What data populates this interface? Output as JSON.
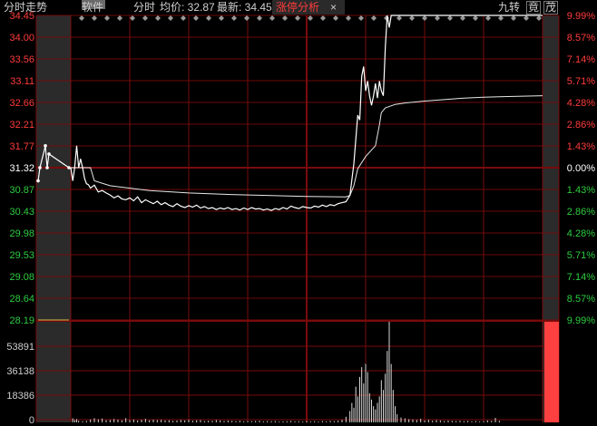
{
  "header": {
    "chart_title": "分时走势",
    "stock_name_suffix": "软件",
    "view_mode": "分时",
    "avg_label": "均价: 32.87",
    "latest_label": "最新: 34.45",
    "tab_label": "涨停分析",
    "tab_close": "×",
    "right_buttons": [
      "九转",
      "竟",
      "茂"
    ]
  },
  "colors": {
    "background": "#000000",
    "grid": "#7a0b0b",
    "price_axis": "#ff3b3b",
    "down_axis": "#2ecc40",
    "price_line": "#ffffff",
    "avg_line": "#e8e8e8",
    "volume": "#d8d8d8",
    "limit_up_bar": "#ff4040"
  },
  "chart_data": {
    "type": "line",
    "prev_close": 31.32,
    "price_range": [
      28.19,
      34.45
    ],
    "y_ticks_left": [
      "34.45",
      "34.00",
      "33.56",
      "33.11",
      "32.66",
      "32.21",
      "31.77",
      "31.32",
      "30.87",
      "30.43",
      "29.98",
      "29.53",
      "29.08",
      "28.64",
      "28.19"
    ],
    "y_ticks_right": [
      "9.99%",
      "8.57%",
      "7.14%",
      "5.71%",
      "4.28%",
      "2.86%",
      "1.43%",
      "0.00%",
      "1.43%",
      "2.86%",
      "4.28%",
      "5.71%",
      "7.14%",
      "8.57%",
      "9.99%"
    ],
    "volume_ticks": [
      "53891",
      "36138",
      "18386",
      "0"
    ],
    "volume_max": 62000,
    "series": [
      {
        "values": [
          [
            0,
            31.32
          ],
          [
            1,
            31.05
          ],
          [
            2,
            31.32
          ],
          [
            3,
            31.77
          ],
          [
            4,
            31.32
          ],
          [
            5,
            31.5
          ],
          [
            6,
            31.32
          ],
          [
            7,
            31.1
          ],
          [
            8,
            30.99
          ],
          [
            9,
            30.97
          ],
          [
            10,
            30.9
          ],
          [
            12,
            30.96
          ],
          [
            14,
            30.82
          ],
          [
            16,
            30.85
          ],
          [
            18,
            30.8
          ],
          [
            20,
            30.76
          ],
          [
            22,
            30.7
          ],
          [
            24,
            30.74
          ],
          [
            26,
            30.68
          ],
          [
            28,
            30.66
          ],
          [
            30,
            30.7
          ],
          [
            32,
            30.64
          ],
          [
            34,
            30.72
          ],
          [
            36,
            30.6
          ],
          [
            38,
            30.66
          ],
          [
            40,
            30.62
          ],
          [
            42,
            30.58
          ],
          [
            44,
            30.63
          ],
          [
            46,
            30.56
          ],
          [
            48,
            30.6
          ],
          [
            50,
            30.55
          ],
          [
            52,
            30.52
          ],
          [
            54,
            30.58
          ],
          [
            56,
            30.53
          ],
          [
            58,
            30.5
          ],
          [
            60,
            30.54
          ],
          [
            62,
            30.51
          ],
          [
            64,
            30.55
          ],
          [
            66,
            30.49
          ],
          [
            68,
            30.52
          ],
          [
            70,
            30.48
          ],
          [
            72,
            30.5
          ],
          [
            74,
            30.46
          ],
          [
            76,
            30.49
          ],
          [
            78,
            30.47
          ],
          [
            80,
            30.5
          ],
          [
            82,
            30.46
          ],
          [
            84,
            30.48
          ],
          [
            86,
            30.45
          ],
          [
            88,
            30.49
          ],
          [
            90,
            30.46
          ],
          [
            92,
            30.5
          ],
          [
            94,
            30.47
          ],
          [
            96,
            30.48
          ],
          [
            98,
            30.45
          ],
          [
            100,
            30.47
          ],
          [
            102,
            30.44
          ],
          [
            104,
            30.48
          ],
          [
            106,
            30.46
          ],
          [
            108,
            30.5
          ],
          [
            110,
            30.47
          ],
          [
            112,
            30.53
          ],
          [
            114,
            30.5
          ],
          [
            116,
            30.48
          ],
          [
            118,
            30.52
          ],
          [
            120,
            30.5
          ],
          [
            122,
            30.49
          ],
          [
            124,
            30.53
          ],
          [
            126,
            30.51
          ],
          [
            128,
            30.55
          ],
          [
            130,
            30.52
          ],
          [
            132,
            30.56
          ],
          [
            134,
            30.54
          ],
          [
            136,
            30.58
          ],
          [
            138,
            30.6
          ],
          [
            140,
            30.62
          ],
          [
            142,
            30.75
          ],
          [
            144,
            31.4
          ],
          [
            146,
            32.4
          ],
          [
            147,
            32.3
          ],
          [
            148,
            33.2
          ],
          [
            149,
            33.4
          ],
          [
            150,
            32.9
          ],
          [
            151,
            33.1
          ],
          [
            152,
            32.8
          ],
          [
            153,
            32.6
          ],
          [
            154,
            32.8
          ],
          [
            155,
            33.05
          ],
          [
            156,
            32.75
          ],
          [
            157,
            33.1
          ],
          [
            158,
            32.9
          ],
          [
            159,
            32.8
          ],
          [
            160,
            33.8
          ],
          [
            161,
            34.45
          ],
          [
            162,
            34.2
          ],
          [
            163,
            34.45
          ],
          [
            166,
            34.45
          ],
          [
            180,
            34.45
          ],
          [
            200,
            34.45
          ],
          [
            230,
            34.45
          ],
          [
            240,
            34.45
          ]
        ]
      },
      {
        "values": [
          [
            0,
            31.32
          ],
          [
            10,
            31.32
          ],
          [
            12,
            31.05
          ],
          [
            20,
            30.95
          ],
          [
            40,
            30.85
          ],
          [
            60,
            30.8
          ],
          [
            80,
            30.77
          ],
          [
            100,
            30.75
          ],
          [
            120,
            30.73
          ],
          [
            140,
            30.72
          ],
          [
            142,
            30.75
          ],
          [
            144,
            30.95
          ],
          [
            146,
            31.3
          ],
          [
            150,
            31.55
          ],
          [
            155,
            31.77
          ],
          [
            157,
            32.2
          ],
          [
            158,
            32.45
          ],
          [
            160,
            32.55
          ],
          [
            165,
            32.62
          ],
          [
            170,
            32.65
          ],
          [
            180,
            32.69
          ],
          [
            190,
            32.72
          ],
          [
            200,
            32.75
          ],
          [
            210,
            32.77
          ],
          [
            220,
            32.78
          ],
          [
            240,
            32.8
          ]
        ]
      }
    ],
    "volume": [
      [
        1,
        2500
      ],
      [
        2,
        1500
      ],
      [
        3,
        2000
      ],
      [
        4,
        1000
      ],
      [
        6,
        600
      ],
      [
        8,
        900
      ],
      [
        10,
        1800
      ],
      [
        12,
        2600
      ],
      [
        14,
        1900
      ],
      [
        16,
        2400
      ],
      [
        18,
        1300
      ],
      [
        20,
        1500
      ],
      [
        22,
        2100
      ],
      [
        24,
        1700
      ],
      [
        26,
        1200
      ],
      [
        28,
        2600
      ],
      [
        30,
        1400
      ],
      [
        32,
        1800
      ],
      [
        34,
        1200
      ],
      [
        36,
        1600
      ],
      [
        38,
        2200
      ],
      [
        40,
        1300
      ],
      [
        42,
        1700
      ],
      [
        44,
        1400
      ],
      [
        46,
        1600
      ],
      [
        48,
        1200
      ],
      [
        50,
        1300
      ],
      [
        52,
        900
      ],
      [
        54,
        1100
      ],
      [
        56,
        1500
      ],
      [
        58,
        1200
      ],
      [
        60,
        1600
      ],
      [
        62,
        1000
      ],
      [
        64,
        1300
      ],
      [
        66,
        1400
      ],
      [
        68,
        800
      ],
      [
        70,
        1000
      ],
      [
        72,
        900
      ],
      [
        74,
        1500
      ],
      [
        76,
        1200
      ],
      [
        78,
        800
      ],
      [
        80,
        1100
      ],
      [
        82,
        900
      ],
      [
        84,
        700
      ],
      [
        86,
        1000
      ],
      [
        88,
        600
      ],
      [
        90,
        800
      ],
      [
        92,
        700
      ],
      [
        94,
        900
      ],
      [
        96,
        1000
      ],
      [
        98,
        600
      ],
      [
        100,
        800
      ],
      [
        102,
        700
      ],
      [
        104,
        800
      ],
      [
        106,
        500
      ],
      [
        108,
        600
      ],
      [
        110,
        700
      ],
      [
        112,
        900
      ],
      [
        114,
        600
      ],
      [
        116,
        700
      ],
      [
        118,
        500
      ],
      [
        120,
        800
      ],
      [
        122,
        600
      ],
      [
        124,
        700
      ],
      [
        126,
        500
      ],
      [
        128,
        800
      ],
      [
        130,
        600
      ],
      [
        132,
        900
      ],
      [
        134,
        700
      ],
      [
        136,
        1000
      ],
      [
        138,
        1600
      ],
      [
        140,
        3500
      ],
      [
        142,
        7000
      ],
      [
        143,
        12000
      ],
      [
        144,
        9000
      ],
      [
        145,
        22000
      ],
      [
        146,
        16000
      ],
      [
        147,
        28000
      ],
      [
        148,
        34000
      ],
      [
        149,
        24000
      ],
      [
        150,
        36000
      ],
      [
        151,
        31000
      ],
      [
        152,
        18000
      ],
      [
        153,
        14000
      ],
      [
        154,
        10000
      ],
      [
        155,
        8000
      ],
      [
        156,
        12000
      ],
      [
        157,
        16000
      ],
      [
        158,
        26000
      ],
      [
        159,
        20000
      ],
      [
        160,
        30000
      ],
      [
        161,
        44000
      ],
      [
        162,
        62000
      ],
      [
        163,
        36000
      ],
      [
        164,
        20000
      ],
      [
        165,
        10000
      ],
      [
        166,
        5000
      ],
      [
        168,
        3000
      ],
      [
        170,
        2500
      ],
      [
        172,
        2000
      ],
      [
        174,
        1800
      ],
      [
        176,
        1500
      ],
      [
        178,
        2200
      ],
      [
        180,
        1200
      ],
      [
        182,
        1600
      ],
      [
        184,
        1000
      ],
      [
        186,
        1400
      ],
      [
        188,
        1200
      ],
      [
        190,
        800
      ],
      [
        192,
        1100
      ],
      [
        194,
        900
      ],
      [
        196,
        800
      ],
      [
        198,
        1000
      ],
      [
        200,
        700
      ],
      [
        202,
        900
      ],
      [
        204,
        600
      ],
      [
        206,
        800
      ],
      [
        208,
        500
      ],
      [
        210,
        700
      ],
      [
        212,
        1200
      ],
      [
        214,
        900
      ],
      [
        216,
        2800
      ],
      [
        218,
        1000
      ]
    ]
  }
}
